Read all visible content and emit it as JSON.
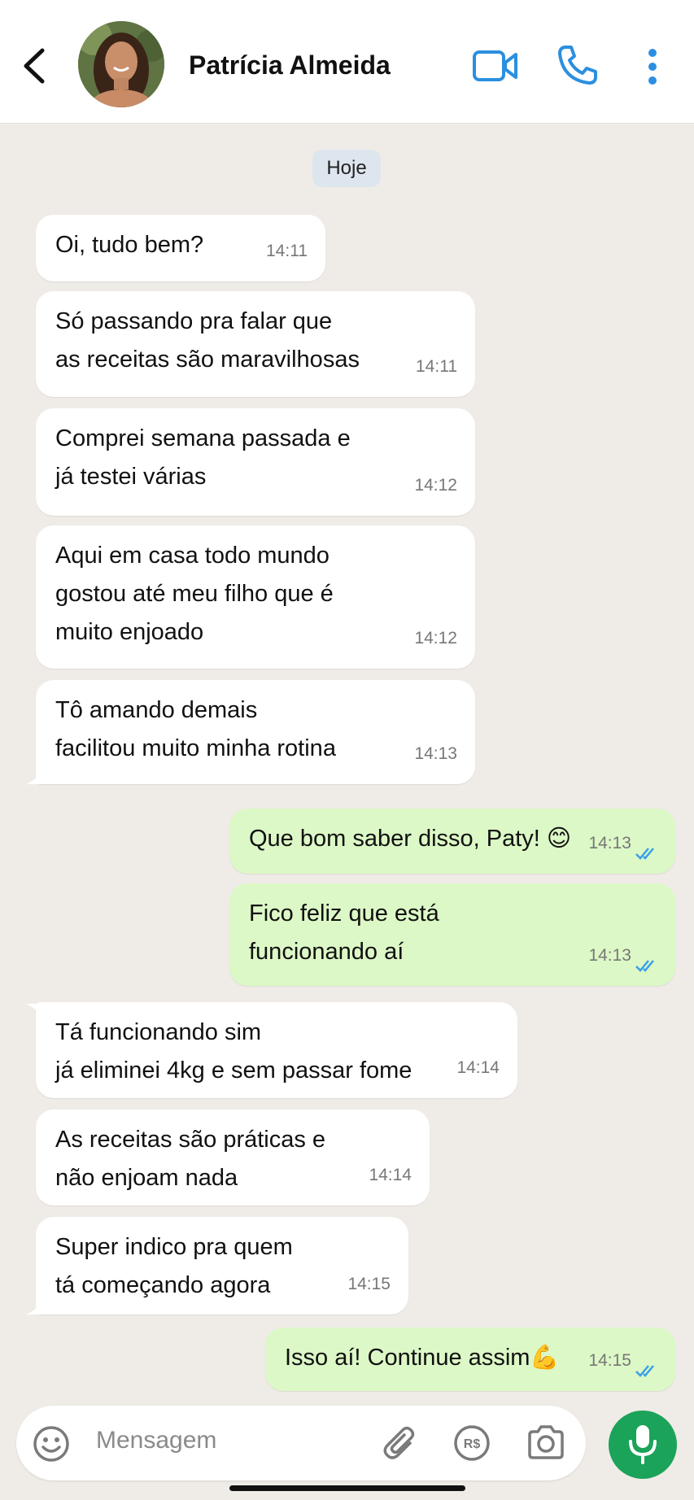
{
  "header": {
    "contact_name": "Patrícia Almeida",
    "icons": [
      "back-arrow-icon",
      "video-call-icon",
      "phone-icon",
      "more-options-icon"
    ],
    "accent_color": "#2b8fe0"
  },
  "chat": {
    "date_label": "Hoje",
    "messages": [
      {
        "direction": "in",
        "text": "Oi, tudo bem?",
        "time": "14:11"
      },
      {
        "direction": "in",
        "text": "Só passando pra falar que\nas receitas são maravilhosas",
        "time": "14:11"
      },
      {
        "direction": "in",
        "text": "Comprei semana passada e\njá testei várias",
        "time": "14:12"
      },
      {
        "direction": "in",
        "text": "Aqui em casa todo mundo\ngostou até meu filho que é\nmuito enjoado",
        "time": "14:12"
      },
      {
        "direction": "in",
        "text": "Tô amando demais\nfacilitou muito minha rotina",
        "time": "14:13"
      },
      {
        "direction": "out",
        "text": "Que bom saber disso, Paty! 😊",
        "time": "14:13",
        "status": "read"
      },
      {
        "direction": "out",
        "text": "Fico feliz que está\nfuncionando aí",
        "time": "14:13",
        "status": "read"
      },
      {
        "direction": "in",
        "text": "Tá funcionando sim\njá eliminei 4kg e sem passar fome",
        "time": "14:14"
      },
      {
        "direction": "in",
        "text": "As receitas são práticas e\nnão enjoam nada",
        "time": "14:14"
      },
      {
        "direction": "in",
        "text": "Super indico pra quem\ntá começando agora",
        "time": "14:15"
      },
      {
        "direction": "out",
        "text": "Isso aí! Continue assim💪",
        "time": "14:15",
        "status": "read"
      }
    ],
    "incoming_color": "#ffffff",
    "outgoing_color": "#dcf8c6",
    "read_tick_color": "#3aa0e8"
  },
  "composer": {
    "placeholder": "Mensagem",
    "icons": [
      "emoji-icon",
      "attach-icon",
      "payment-icon",
      "camera-icon",
      "mic-icon"
    ],
    "mic_color": "#1ba35a"
  }
}
